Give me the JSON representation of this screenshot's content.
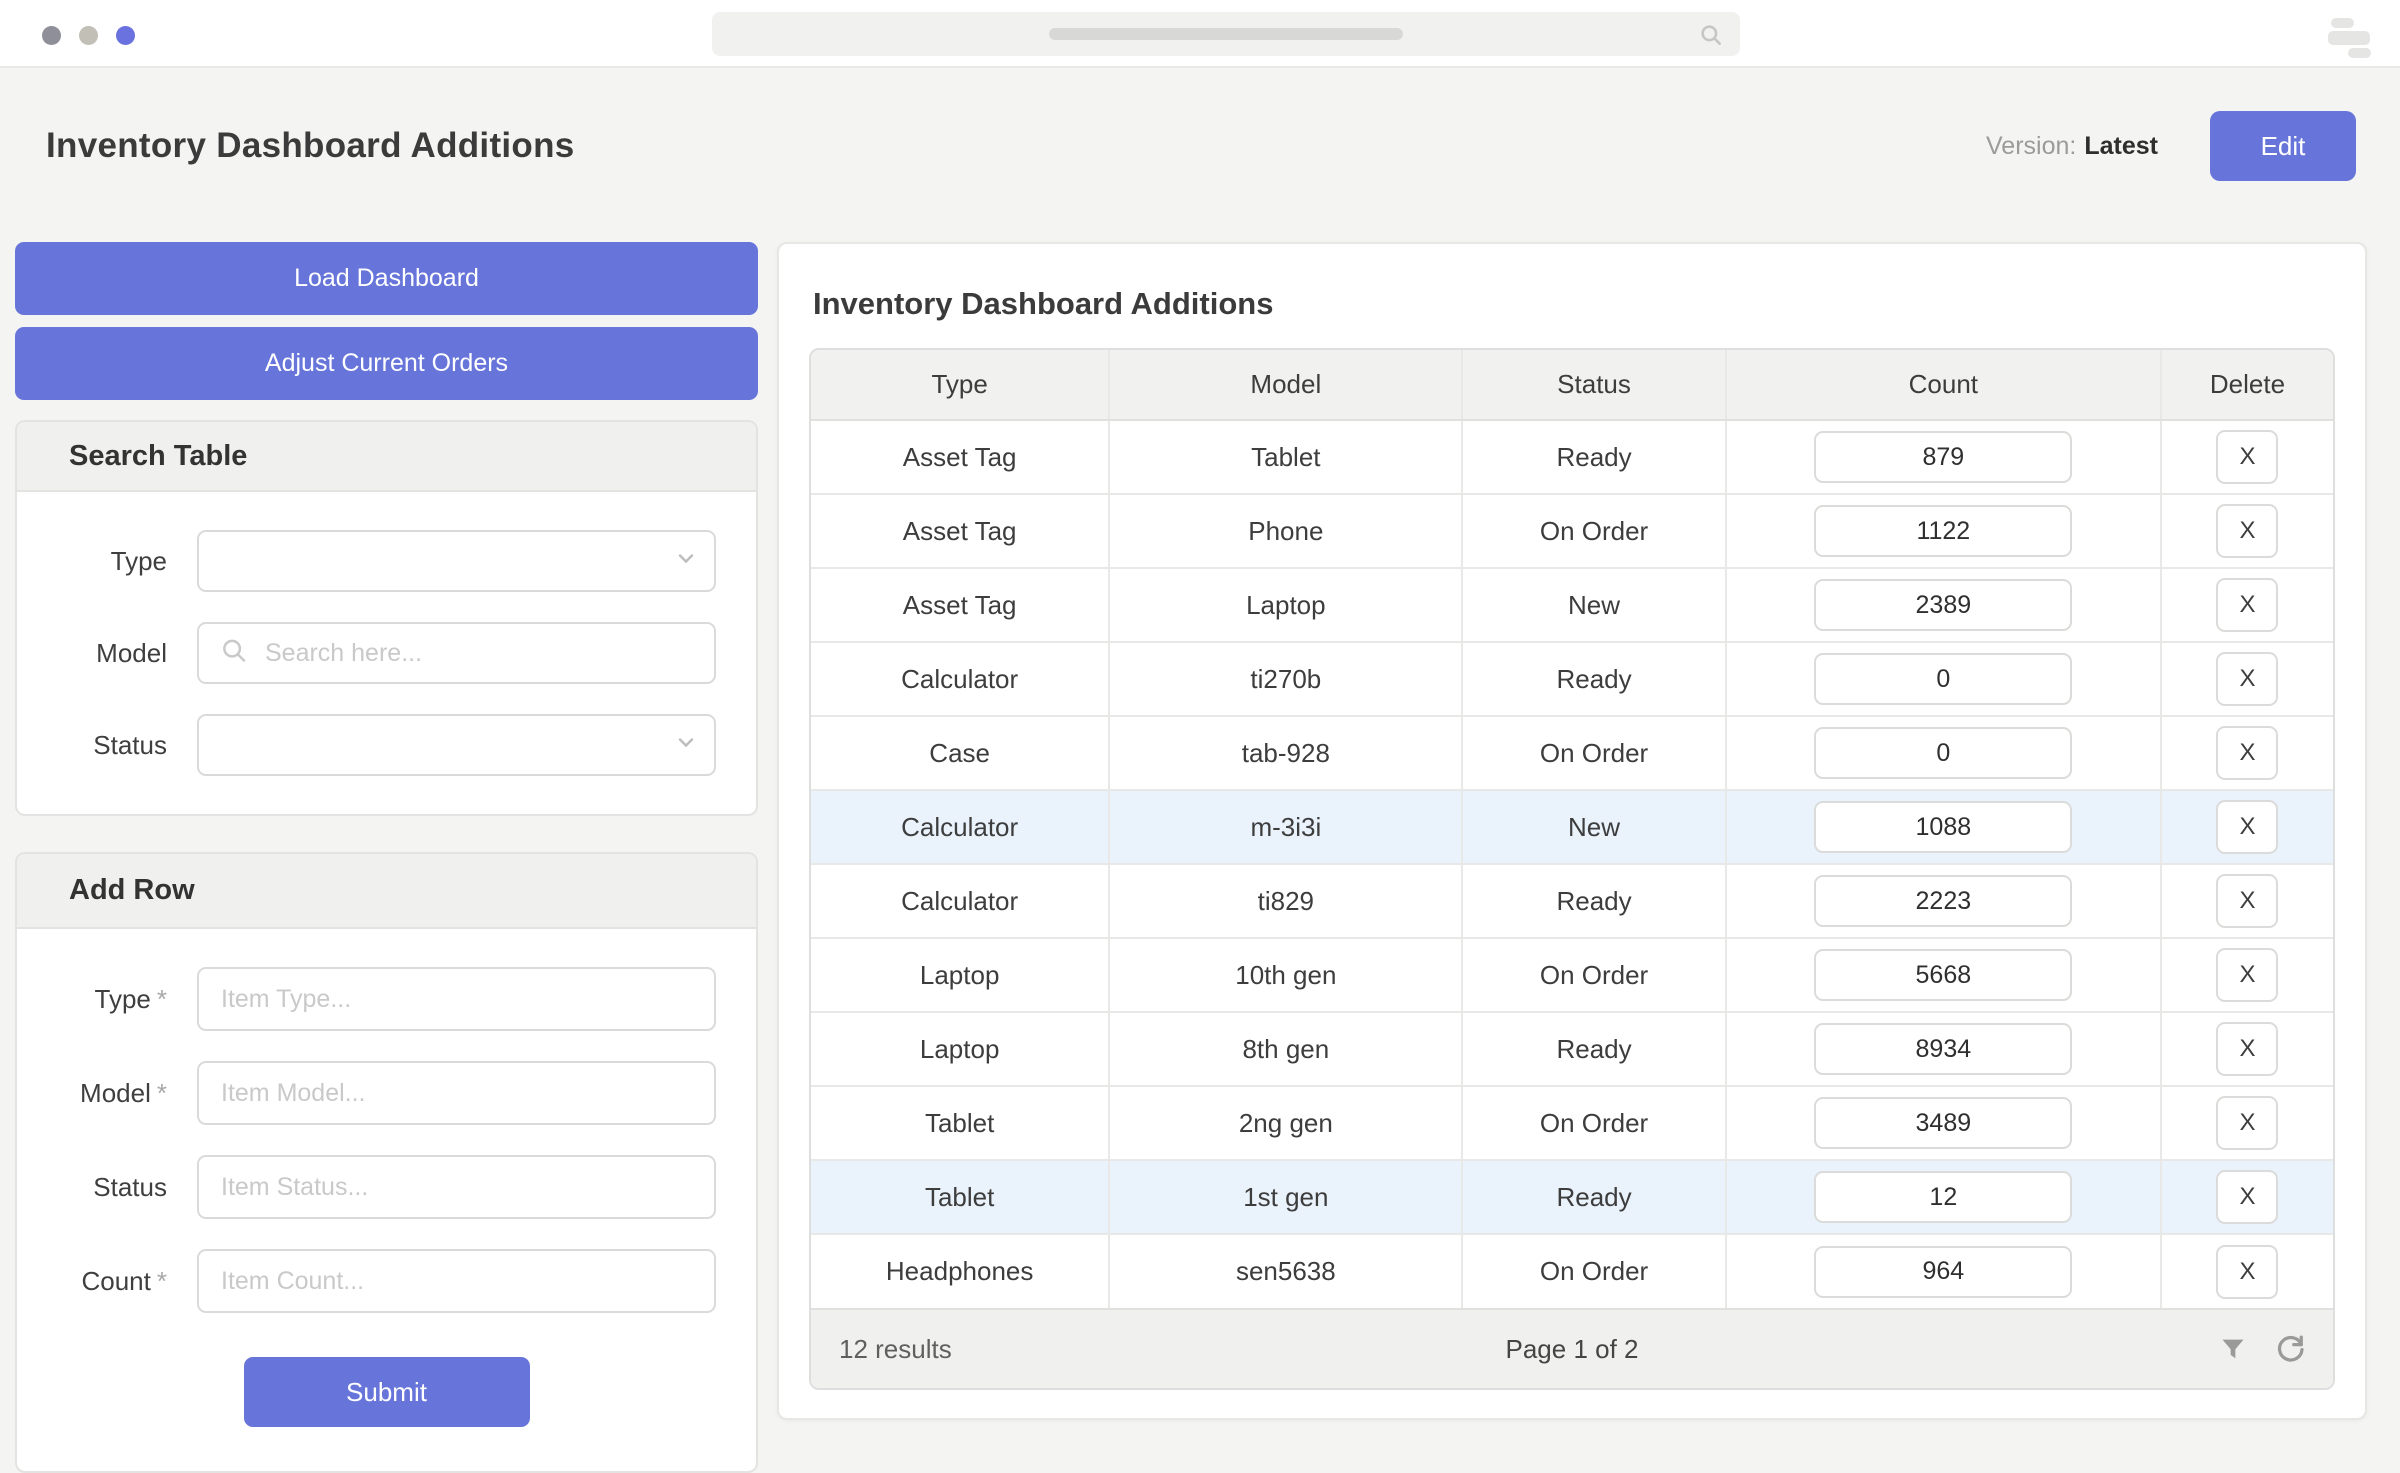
{
  "colors": {
    "accent": "#6775da",
    "row_highlight": "#eaf2fc"
  },
  "page_header": {
    "title": "Inventory Dashboard Additions",
    "version_label": "Version:",
    "version_value": "Latest",
    "edit_button": "Edit"
  },
  "sidebar": {
    "load_dashboard_button": "Load Dashboard",
    "adjust_orders_button": "Adjust Current Orders",
    "search_table": {
      "title": "Search Table",
      "type_label": "Type",
      "model_label": "Model",
      "model_placeholder": "Search here...",
      "status_label": "Status"
    },
    "add_row": {
      "title": "Add Row",
      "type_label": "Type",
      "type_required": "*",
      "type_placeholder": "Item Type...",
      "model_label": "Model",
      "model_required": "*",
      "model_placeholder": "Item Model...",
      "status_label": "Status",
      "status_placeholder": "Item Status...",
      "count_label": "Count",
      "count_required": "*",
      "count_placeholder": "Item Count...",
      "submit_button": "Submit"
    }
  },
  "main": {
    "title": "Inventory Dashboard Additions",
    "table": {
      "columns": [
        "Type",
        "Model",
        "Status",
        "Count",
        "Delete"
      ],
      "delete_label": "X",
      "rows": [
        {
          "type": "Asset Tag",
          "model": "Tablet",
          "status": "Ready",
          "count": "879",
          "highlighted": false
        },
        {
          "type": "Asset Tag",
          "model": "Phone",
          "status": "On Order",
          "count": "1122",
          "highlighted": false
        },
        {
          "type": "Asset Tag",
          "model": "Laptop",
          "status": "New",
          "count": "2389",
          "highlighted": false
        },
        {
          "type": "Calculator",
          "model": "ti270b",
          "status": "Ready",
          "count": "0",
          "highlighted": false
        },
        {
          "type": "Case",
          "model": "tab-928",
          "status": "On Order",
          "count": "0",
          "highlighted": false
        },
        {
          "type": "Calculator",
          "model": "m-3i3i",
          "status": "New",
          "count": "1088",
          "highlighted": true
        },
        {
          "type": "Calculator",
          "model": "ti829",
          "status": "Ready",
          "count": "2223",
          "highlighted": false
        },
        {
          "type": "Laptop",
          "model": "10th gen",
          "status": "On Order",
          "count": "5668",
          "highlighted": false
        },
        {
          "type": "Laptop",
          "model": "8th gen",
          "status": "Ready",
          "count": "8934",
          "highlighted": false
        },
        {
          "type": "Tablet",
          "model": "2ng gen",
          "status": "On Order",
          "count": "3489",
          "highlighted": false
        },
        {
          "type": "Tablet",
          "model": "1st gen",
          "status": "Ready",
          "count": "12",
          "highlighted": true
        },
        {
          "type": "Headphones",
          "model": "sen5638",
          "status": "On Order",
          "count": "964",
          "highlighted": false
        }
      ],
      "footer": {
        "results": "12 results",
        "page": "Page 1 of 2"
      }
    }
  }
}
